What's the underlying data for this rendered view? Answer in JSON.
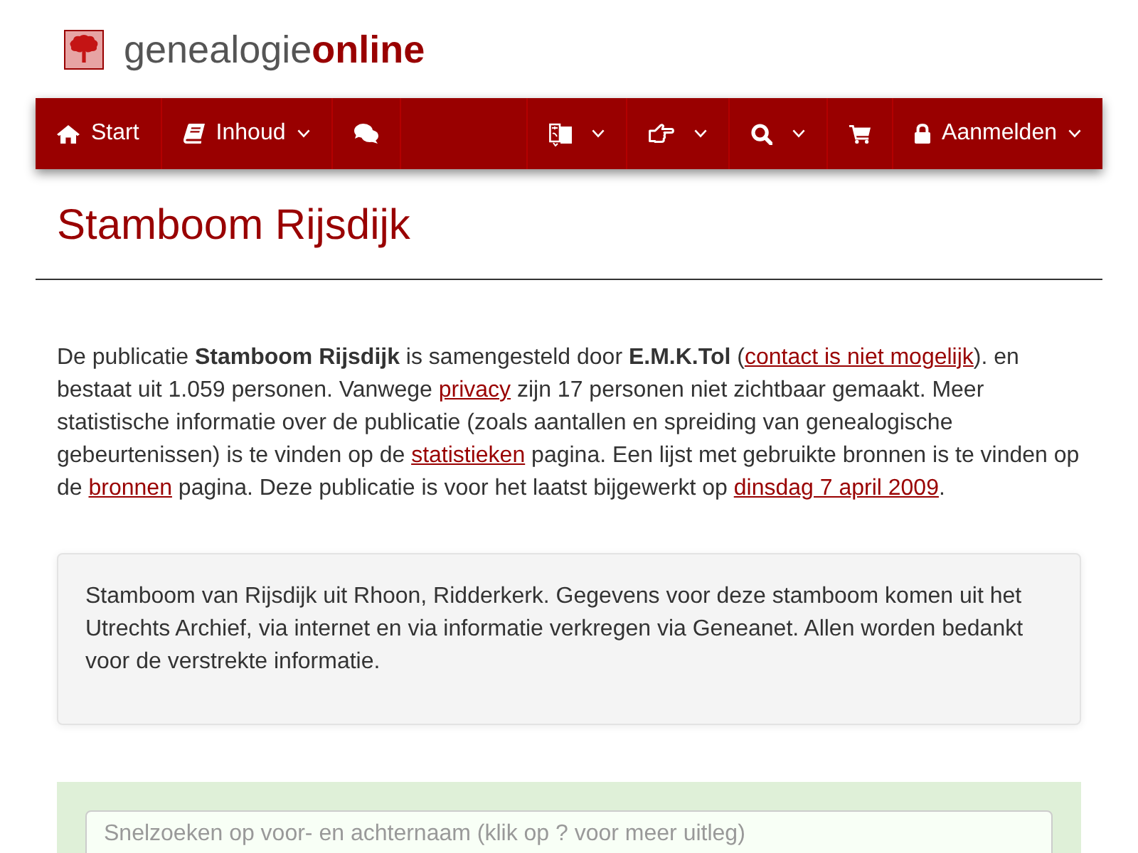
{
  "logo": {
    "text": "genealogie**online**"
  },
  "nav": {
    "left": [
      {
        "label": "Start",
        "dropdown": false
      },
      {
        "label": "Inhoud",
        "dropdown": true
      },
      {
        "dropdown": false
      }
    ],
    "right": [
      {
        "dropdown": true
      },
      {
        "dropdown": true
      },
      {
        "dropdown": true
      },
      {
        "dropdown": false
      },
      {
        "label": "Aanmelden",
        "dropdown": true
      }
    ]
  },
  "page_title": "Stamboom Rijsdijk",
  "intro": [
    {
      "kind": "text",
      "text": "De publicatie **Stamboom Rijsdijk** is samengesteld door **E.M.K.Tol** ("
    },
    {
      "kind": "link",
      "text": "contact is niet mogelijk"
    },
    {
      "kind": "text",
      "text": "). en bestaat uit 1.059 personen. Vanwege "
    },
    {
      "kind": "link",
      "text": "privacy"
    },
    {
      "kind": "text",
      "text": " zijn 17 personen niet zichtbaar gemaakt. Meer statistische informatie over de publicatie (zoals aantallen en spreiding van genealogische gebeurtenissen) is te vinden op de "
    },
    {
      "kind": "link",
      "text": "statistieken"
    },
    {
      "kind": "text",
      "text": " pagina. Een lijst met gebruikte bronnen is te vinden op de "
    },
    {
      "kind": "link",
      "text": "bronnen"
    },
    {
      "kind": "text",
      "text": " pagina. Deze publicatie is voor het laatst bijgewerkt op "
    },
    {
      "kind": "link",
      "text": "dinsdag 7 april 2009"
    },
    {
      "kind": "text",
      "text": "."
    }
  ],
  "description": {
    "text": "Stamboom van Rijsdijk uit Rhoon, Ridderkerk. Gegevens voor deze stamboom komen uit het Utrechts Archief, via internet en via informatie verkregen via Geneanet. Allen worden bedankt voor de verstrekte informatie."
  },
  "search": {
    "placeholder": "Snelzoeken op voor- en achternaam (klik op ? voor meer uitleg)"
  }
}
